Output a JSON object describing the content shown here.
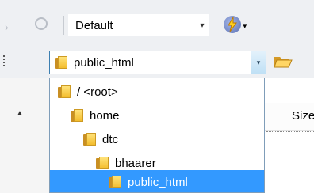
{
  "toolbar": {
    "profile_value": "Default",
    "profile_arrow": "▾",
    "action_arrow": "▾"
  },
  "address": {
    "path": "public_html",
    "arrow": "▾"
  },
  "folder_tree": {
    "items": [
      {
        "label": "/ <root>"
      },
      {
        "label": "home"
      },
      {
        "label": "dtc"
      },
      {
        "label": "bhaarer"
      },
      {
        "label": "public_html"
      }
    ],
    "selected_item": "public_html"
  },
  "file_list": {
    "size_column": "Size"
  },
  "colors": {
    "selection": "#3399ff",
    "folder_yellow": "#f3bd2e",
    "dropdown_border": "#7f9db9"
  },
  "icons": [
    "forward-icon",
    "refresh-icon",
    "lightning-icon",
    "folder-icon",
    "open-folder-icon",
    "tree-view-icon",
    "scroll-up-icon"
  ]
}
